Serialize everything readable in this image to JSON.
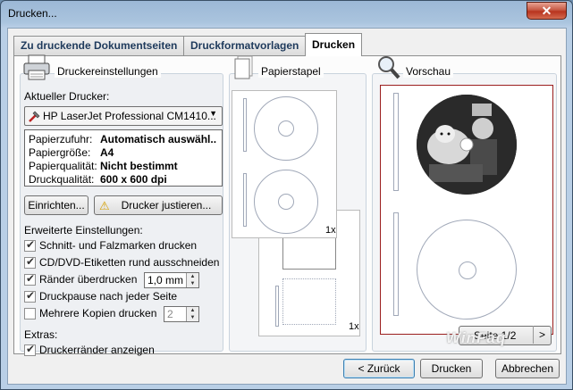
{
  "window": {
    "title": "Drucken...",
    "close_glyph": "✕"
  },
  "tabs": [
    {
      "label": "Zu druckende Dokumentseiten",
      "active": false
    },
    {
      "label": "Druckformatvorlagen",
      "active": false
    },
    {
      "label": "Drucken",
      "active": true
    }
  ],
  "settings": {
    "title": "Druckereinstellungen",
    "current_printer_label": "Aktueller Drucker:",
    "printer_value": "HP LaserJet Professional CM1410...",
    "info": [
      {
        "key": "Papierzufuhr:",
        "value": "Automatisch auswähl.."
      },
      {
        "key": "Papiergröße:",
        "value": "A4"
      },
      {
        "key": "Papierqualität:",
        "value": "Nicht bestimmt"
      },
      {
        "key": "Druckqualität:",
        "value": "600 x 600 dpi"
      }
    ],
    "setup_button": "Einrichten...",
    "adjust_button": "Drucker justieren...",
    "advanced_label": "Erweiterte Einstellungen:",
    "opt_cutmarks": "Schnitt- und Falzmarken drucken",
    "opt_cd": "CD/DVD-Etiketten rund ausschneiden",
    "opt_margins": "Ränder überdrucken",
    "margins_value": "1,0 mm",
    "opt_pause": "Druckpause nach jeder Seite",
    "opt_copies": "Mehrere Kopien drucken",
    "copies_value": "2",
    "extras_label": "Extras:",
    "opt_printer_margins": "Druckerränder anzeigen"
  },
  "stack": {
    "title": "Papierstapel",
    "count_top": "1x",
    "count_bottom": "1x"
  },
  "preview": {
    "title": "Vorschau",
    "page_label": "Seite 1/2",
    "next_glyph": ">"
  },
  "footer": {
    "back": "< Zurück",
    "print": "Drucken",
    "cancel": "Abbrechen"
  },
  "watermark": "WinFaq"
}
